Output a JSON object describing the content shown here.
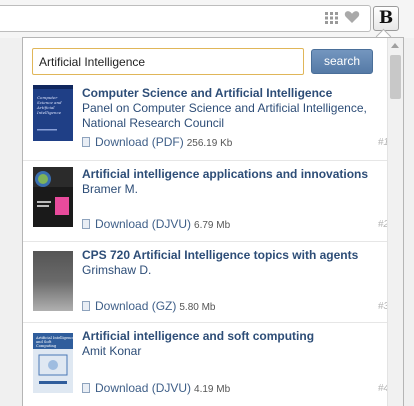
{
  "search": {
    "value": "Artificial Intelligence",
    "button_label": "search"
  },
  "extension_button_label": "B",
  "results": [
    {
      "title": "Computer Science and Artificial Intelligence",
      "author": "Panel on Computer Science and Artificial Intelligence, National Research Council",
      "download_label": "Download (PDF)",
      "size": "256.19 Kb",
      "number": "#1",
      "cover_text": "Computer Science and Artificial Intelligence"
    },
    {
      "title": "Artificial intelligence applications and innovations",
      "author": "Bramer M.",
      "download_label": "Download (DJVU)",
      "size": "6.79 Mb",
      "number": "#2",
      "cover_text": ""
    },
    {
      "title": "CPS 720 Artificial Intelligence topics with agents",
      "author": "Grimshaw D.",
      "download_label": "Download (GZ)",
      "size": "5.80 Mb",
      "number": "#3",
      "cover_text": ""
    },
    {
      "title": "Artificial intelligence and soft computing",
      "author": "Amit Konar",
      "download_label": "Download (DJVU)",
      "size": "4.19 Mb",
      "number": "#4",
      "cover_text": "Artificial Intelligence and Soft Computing"
    }
  ],
  "colors": {
    "link": "#2d4d77",
    "button": "#5f82ad",
    "input_border": "#e0b659"
  }
}
